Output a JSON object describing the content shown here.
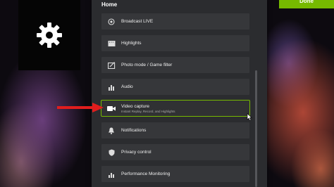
{
  "panel": {
    "title": "Home",
    "items": [
      {
        "label": "Broadcast LIVE",
        "icon": "broadcast-icon"
      },
      {
        "label": "Highlights",
        "icon": "film-icon"
      },
      {
        "label": "Photo mode / Game filter",
        "icon": "photo-filter-icon"
      },
      {
        "label": "Audio",
        "icon": "audio-bars-icon"
      },
      {
        "label": "Video capture",
        "sublabel": "Instant Replay, Record, and Highlights",
        "icon": "video-camera-icon",
        "selected": true
      },
      {
        "label": "Notifications",
        "icon": "bell-icon"
      },
      {
        "label": "Privacy control",
        "icon": "shield-icon"
      },
      {
        "label": "Performance Monitoring",
        "icon": "performance-bars-icon"
      }
    ]
  },
  "done_button": {
    "label": "Done"
  },
  "colors": {
    "accent": "#76b900",
    "panel": "#2b2c2f",
    "item": "#36373a",
    "arrow": "#e11d1d"
  }
}
